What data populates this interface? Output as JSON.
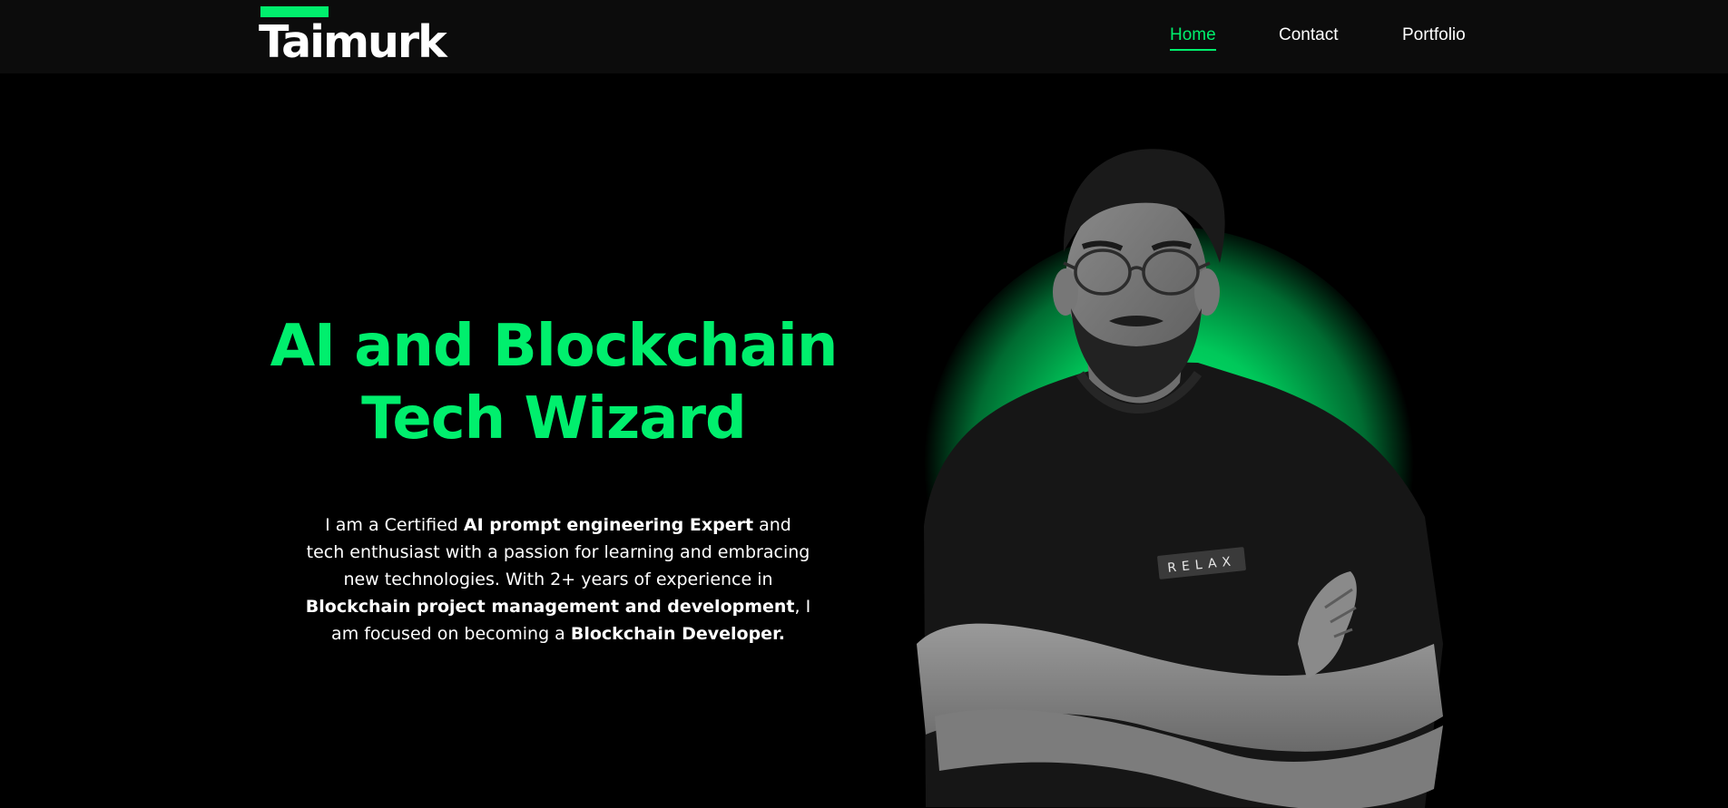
{
  "header": {
    "logo": "Taimurk",
    "nav": [
      {
        "label": "Home",
        "active": true
      },
      {
        "label": "Contact",
        "active": false
      },
      {
        "label": "Portfolio",
        "active": false
      }
    ]
  },
  "hero": {
    "title_line1": "AI and Blockchain",
    "title_line2": "Tech Wizard",
    "intro": {
      "t1": "I am a Certified ",
      "b1": "AI prompt engineering Expert",
      "t2": " and tech enthusiast with a passion for learning and embracing new technologies. With 2+ years of experience in ",
      "b2": "Blockchain project management and development",
      "t3": ", I am focused on becoming a ",
      "b3": "Blockchain Developer."
    },
    "shirt_text": "RELAX"
  },
  "colors": {
    "accent": "#00ef6d",
    "header_bg": "#0c0c0c",
    "page_bg": "#000000"
  }
}
